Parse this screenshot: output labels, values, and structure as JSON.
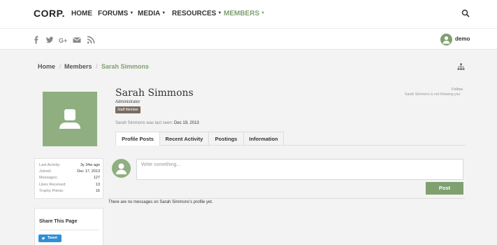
{
  "nav": {
    "logo": "CORP.",
    "items": [
      {
        "label": "HOME",
        "dropdown": false
      },
      {
        "label": "FORUMS",
        "dropdown": true
      },
      {
        "label": "MEDIA",
        "dropdown": true
      },
      {
        "label": "RESOURCES",
        "dropdown": true
      },
      {
        "label": "MEMBERS",
        "dropdown": true,
        "active": true
      }
    ],
    "search_icon": "search-icon"
  },
  "social": {
    "icons": [
      "facebook-icon",
      "twitter-icon",
      "google-plus-icon",
      "mail-icon",
      "rss-icon"
    ],
    "user": "demo"
  },
  "breadcrumb": {
    "items": [
      "Home",
      "Members",
      "Sarah Simmons"
    ],
    "separator": "/"
  },
  "profile": {
    "name": "Sarah Simmons",
    "title": "Administrator",
    "badge": "Staff Member",
    "last_seen_label": "Sarah Simmons was last seen:",
    "last_seen_value": "Dec 19, 2013",
    "follow": "Follow",
    "follow_status": "Sarah Simmons is not following you"
  },
  "tabs": [
    "Profile Posts",
    "Recent Activity",
    "Postings",
    "Information"
  ],
  "active_tab": "Profile Posts",
  "stats": [
    {
      "label": "Last Activity:",
      "value": "3y 34w ago"
    },
    {
      "label": "Joined:",
      "value": "Dec 17, 2013"
    },
    {
      "label": "Messages:",
      "value": "127"
    },
    {
      "label": "Likes Received:",
      "value": "13"
    },
    {
      "label": "Trophy Points:",
      "value": "16"
    }
  ],
  "share": {
    "title": "Share This Page",
    "tweet": "Tweet"
  },
  "post": {
    "placeholder": "Write something...",
    "button": "Post",
    "empty_message": "There are no messages on Sarah Simmons's profile yet."
  },
  "colors": {
    "accent": "#7fa06f",
    "badge": "#7a6b62",
    "tweet": "#2f8fd8"
  }
}
